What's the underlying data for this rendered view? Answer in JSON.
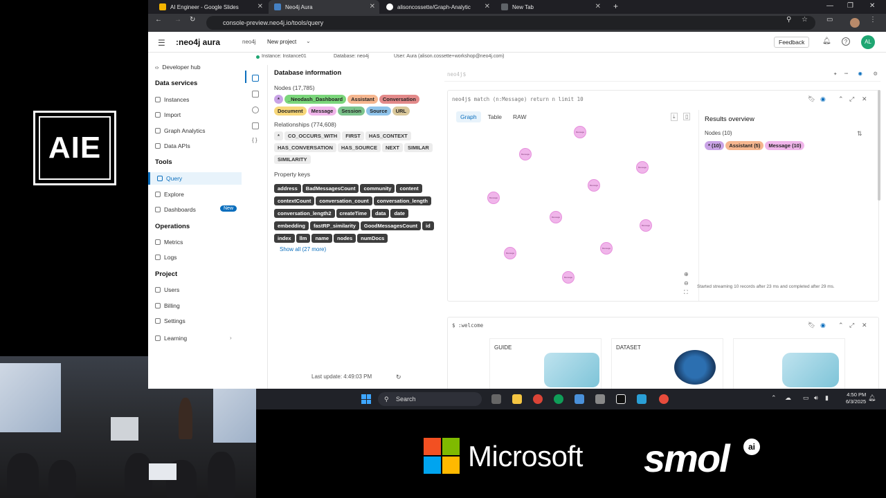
{
  "stream": {
    "logo_text": "AIE",
    "sponsor1": "Microsoft",
    "sponsor2": "smol",
    "sponsor2_badge": "ai"
  },
  "browser": {
    "tabs": [
      {
        "label": "AI Engineer - Google Slides",
        "active": false
      },
      {
        "label": "Neo4j Aura",
        "active": true
      },
      {
        "label": "alisoncossette/Graph-Analytic",
        "active": false
      },
      {
        "label": "New Tab",
        "active": false
      }
    ],
    "url": "console-preview.neo4j.io/tools/query"
  },
  "header": {
    "brand": ":neo4j aura",
    "org": "neo4j",
    "project": "New project",
    "feedback": "Feedback",
    "avatar": "AL"
  },
  "subheader": {
    "instance": "Instance: Instance01",
    "database": "Database: neo4j",
    "user": "User: Aura (alison.cossette+workshop@neo4j.com)"
  },
  "sidebar": {
    "dev_hub": "Developer hub",
    "data_services": "Data services",
    "instances": "Instances",
    "import": "Import",
    "graph_analytics": "Graph Analytics",
    "data_apis": "Data APIs",
    "tools": "Tools",
    "query": "Query",
    "explore": "Explore",
    "dashboards": "Dashboards",
    "new_badge": "New",
    "operations": "Operations",
    "metrics": "Metrics",
    "logs": "Logs",
    "project": "Project",
    "users": "Users",
    "billing": "Billing",
    "settings": "Settings",
    "learning": "Learning"
  },
  "dbinfo": {
    "title": "Database information",
    "nodes_label": "Nodes (17,785)",
    "node_labels": [
      {
        "label": "*",
        "color": "#c9a3e6"
      },
      {
        "label": "_Neodash_Dashboard",
        "color": "#7bd67b"
      },
      {
        "label": "Assistant",
        "color": "#f5b68f"
      },
      {
        "label": "Conversation",
        "color": "#e38a8a"
      },
      {
        "label": "Document",
        "color": "#f7d77a"
      },
      {
        "label": "Message",
        "color": "#f0b5ea"
      },
      {
        "label": "Session",
        "color": "#7cc48c"
      },
      {
        "label": "Source",
        "color": "#8fc3ea"
      },
      {
        "label": "URL",
        "color": "#d9c79a"
      }
    ],
    "rels_label": "Relationships (774,608)",
    "relationships": [
      "*",
      "CO_OCCURS_WITH",
      "FIRST",
      "HAS_CONTEXT",
      "HAS_CONVERSATION",
      "HAS_SOURCE",
      "NEXT",
      "SIMILAR",
      "SIMILARITY"
    ],
    "props_label": "Property keys",
    "properties": [
      "address",
      "BadMessagesCount",
      "community",
      "content",
      "contextCount",
      "conversation_count",
      "conversation_length",
      "conversation_length2",
      "createTime",
      "data",
      "date",
      "embedding",
      "fastRP_similarity",
      "GoodMessagesCount",
      "id",
      "index",
      "llm",
      "name",
      "nodes",
      "numDocs"
    ],
    "show_all": "Show all (27 more)",
    "last_update": "Last update: 4:49:03 PM"
  },
  "query": {
    "prompt": "neo4j$",
    "card1_query": "neo4j$  match (n:Message) return n limit 10",
    "tabs": [
      "Graph",
      "Table",
      "RAW"
    ],
    "results_title": "Results overview",
    "nodes_count": "Nodes (10)",
    "result_pills": [
      {
        "label": "* (10)",
        "color": "#c9a3e6"
      },
      {
        "label": "Assistant (5)",
        "color": "#f5b68f"
      },
      {
        "label": "Message (10)",
        "color": "#f0b5ea"
      }
    ],
    "status": "Started streaming 10 records after 23 ms and completed after 29 ms.",
    "node_caption": "Message",
    "card2_query": "$  :welcome",
    "guide": "GUIDE",
    "dataset": "DATASET"
  },
  "taskbar": {
    "search": "Search",
    "time": "4:50 PM",
    "date": "6/3/2025"
  }
}
